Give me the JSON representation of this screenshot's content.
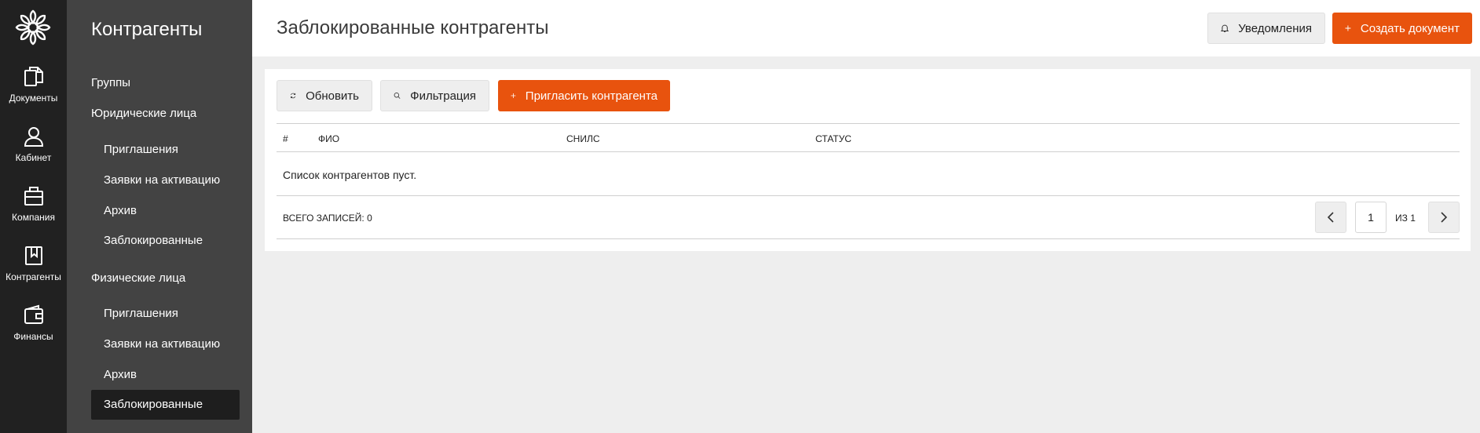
{
  "rail": {
    "items": [
      {
        "label": "Документы",
        "icon": "documents-icon"
      },
      {
        "label": "Кабинет",
        "icon": "user-icon"
      },
      {
        "label": "Компания",
        "icon": "briefcase-icon"
      },
      {
        "label": "Контрагенты",
        "icon": "bookmark-book-icon"
      },
      {
        "label": "Финансы",
        "icon": "wallet-icon"
      }
    ]
  },
  "sidebar": {
    "title": "Контрагенты",
    "groups": {
      "groups_label": "Группы",
      "legal_label": "Юридические лица",
      "individuals_label": "Физические лица"
    },
    "legal_items": [
      "Приглашения",
      "Заявки на активацию",
      "Архив",
      "Заблокированные"
    ],
    "individual_items": [
      "Приглашения",
      "Заявки на активацию",
      "Архив",
      "Заблокированные"
    ],
    "active_item": "Заблокированные"
  },
  "header": {
    "title": "Заблокированные контрагенты",
    "notifications_label": "Уведомления",
    "create_label": "Создать документ"
  },
  "toolbar": {
    "refresh_label": "Обновить",
    "filter_label": "Фильтрация",
    "invite_label": "Пригласить контрагента"
  },
  "table": {
    "columns": [
      "#",
      "ФИО",
      "СНИЛС",
      "СТАТУС"
    ],
    "empty_text": "Список контрагентов пуст."
  },
  "footer": {
    "total_label": "ВСЕГО ЗАПИСЕЙ: 0",
    "page_value": "1",
    "of_label": "ИЗ 1"
  },
  "colors": {
    "accent": "#e8530e",
    "rail_bg": "#212121",
    "sidebar_bg": "#434343",
    "active_item_bg": "#1e1e1e"
  }
}
